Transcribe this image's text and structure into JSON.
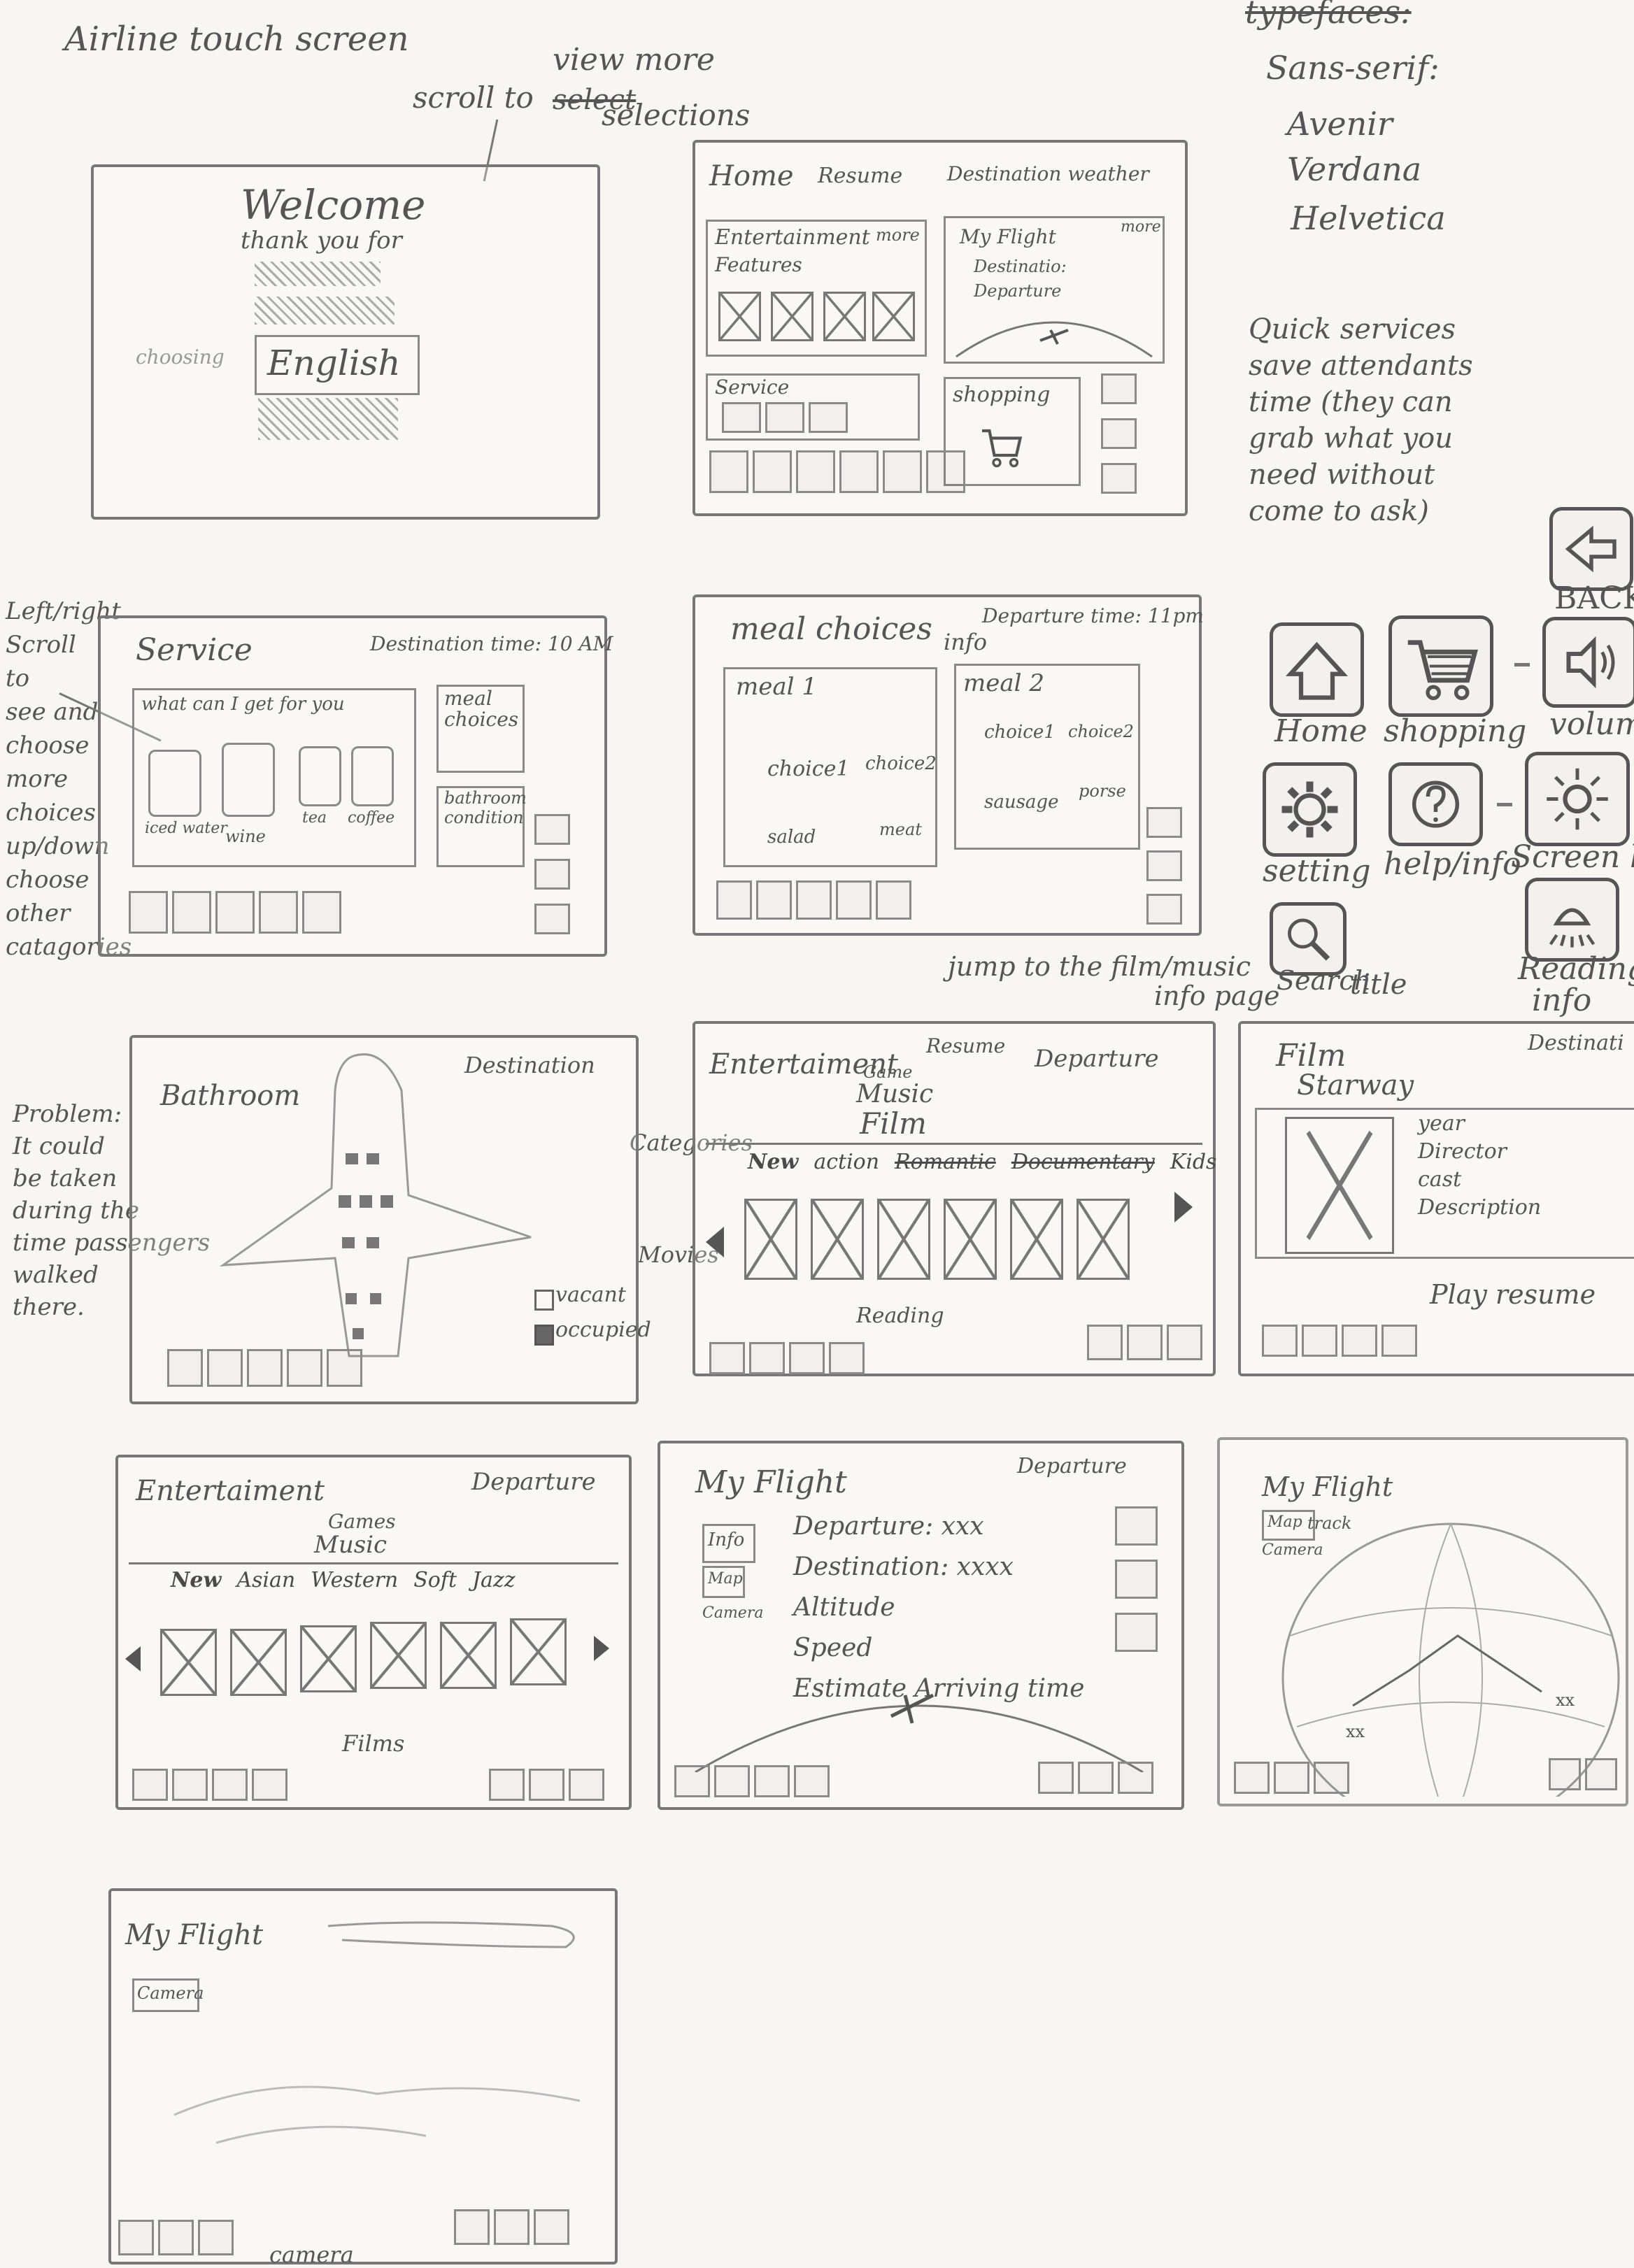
{
  "page_title": "Airline touch screen",
  "notes": {
    "scroll_to_view": "scroll to",
    "scroll_struck": "select",
    "scroll_view_more": "view more",
    "scroll_selections": "selections",
    "left_right_scroll": [
      "Left/right",
      "Scroll",
      "to",
      "see and",
      "choose",
      "more",
      "choices",
      "up/down",
      "choose",
      "other",
      "catagories"
    ],
    "problem": [
      "Problem:",
      "It could",
      "be taken",
      "during the",
      "time passengers",
      "walked",
      "there."
    ],
    "jump_to_film": "jump to the film/music",
    "jump_info_page": "info page",
    "title": "title",
    "categories": "Categories",
    "movies": "Movies",
    "info": "info"
  },
  "typefaces": {
    "heading": "typefaces:",
    "items": [
      "Sans-serif:",
      "Avenir",
      "Verdana",
      "Helvetica"
    ]
  },
  "quick_services": [
    "Quick services",
    "save attendants",
    "time (they can",
    "grab what you",
    "need without",
    "come to ask)"
  ],
  "icon_legend": [
    {
      "label": "BACK",
      "icon": "back-arrow-icon"
    },
    {
      "label": "Home",
      "icon": "home-icon"
    },
    {
      "label": "shopping",
      "icon": "cart-icon"
    },
    {
      "label": "volum",
      "icon": "volume-icon"
    },
    {
      "label": "setting",
      "icon": "gear-icon"
    },
    {
      "label": "help/info",
      "icon": "help-icon"
    },
    {
      "label": "Screen ligh",
      "icon": "sun-icon"
    },
    {
      "label": "Search",
      "icon": "search-icon"
    },
    {
      "label": "Reading",
      "icon": "reading-light-icon"
    },
    {
      "label": "info",
      "icon": ""
    }
  ],
  "screens": {
    "welcome": {
      "title": "Welcome",
      "sub": "thank you for",
      "language": "English",
      "choosing": "choosing"
    },
    "home": {
      "home": "Home",
      "resume": "Resume",
      "destination_weather": "Destination weather",
      "entertainment": "Entertainment",
      "more": "more",
      "features": "Features",
      "my_flight": "My Flight",
      "more2": "more",
      "destination": "Destinatio:",
      "departure": "Departure",
      "service": "Service",
      "shopping": "shopping"
    },
    "service": {
      "title": "Service",
      "dest_time": "Destination time: 10 AM",
      "what_can": "what can I get for you",
      "items": [
        "iced water",
        "wine",
        "tea",
        "coffee"
      ],
      "meal": "meal",
      "choices": "choices",
      "bathroom": "bathroom",
      "condition": "condition"
    },
    "meal": {
      "title": "meal choices",
      "dep_time": "Departure time: 11pm",
      "meal1": "meal 1",
      "meal2": "meal 2",
      "choice1": "choice1",
      "choice2": "choice2",
      "choice1b": "choice1",
      "choice2b": "choice2",
      "salad": "salad",
      "meat": "meat",
      "sausage": "sausage",
      "porse": "porse"
    },
    "bathroom": {
      "title": "Bathroom",
      "destination": "Destination",
      "vacant": "vacant",
      "occupied": "occupied"
    },
    "entertainment_film": {
      "title": "Entertaiment",
      "resume": "Resume",
      "departure": "Departure",
      "game": "Game",
      "music": "Music",
      "film": "Film",
      "cats": [
        "New",
        "action",
        "Romantic",
        "Documentary",
        "Kids"
      ],
      "reading": "Reading"
    },
    "film_info": {
      "title": "Film",
      "name": "Starway",
      "destination": "Destinati",
      "details": [
        "year",
        "Director",
        "cast",
        "Description"
      ],
      "play_resume": "Play resume"
    },
    "entertainment_music": {
      "title": "Entertaiment",
      "departure": "Departure",
      "games": "Games",
      "music": "Music",
      "cats": [
        "New",
        "Asian",
        "Western",
        "Soft",
        "Jazz"
      ],
      "films": "Films"
    },
    "my_flight": {
      "title": "My Flight",
      "departure_top": "Departure",
      "info": "Info",
      "map": "Map",
      "camera": "Camera",
      "lines": [
        "Departure: xxx",
        "Destination: xxxx",
        "Altitude",
        "Speed",
        "Estimate Arriving time"
      ]
    },
    "my_flight_map": {
      "title": "My Flight",
      "map": "Map",
      "track": "track",
      "camera": "Camera"
    },
    "my_flight_camera": {
      "title": "My Flight",
      "camera": "Camera",
      "bottom": "camera"
    }
  }
}
